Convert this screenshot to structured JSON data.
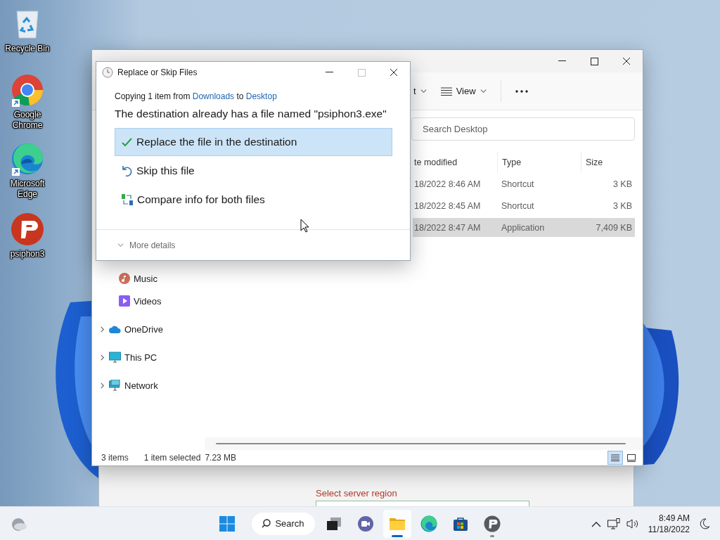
{
  "desktop_icons": [
    {
      "kind": "recycle",
      "label": "Recycle Bin",
      "shortcut": false
    },
    {
      "kind": "chrome",
      "label": "Google Chrome",
      "shortcut": true
    },
    {
      "kind": "edge",
      "label": "Microsoft Edge",
      "shortcut": true
    },
    {
      "kind": "psiphon",
      "label": "psiphon3",
      "shortcut": false
    }
  ],
  "background_window": {
    "field_label": "Select server region"
  },
  "explorer": {
    "toolbar": [
      {
        "kind": "dropdown",
        "label": "t"
      },
      {
        "kind": "view",
        "label": "View"
      }
    ],
    "search": {
      "placeholder": "Search Desktop"
    },
    "columns": [
      "te modified",
      "Type",
      "Size"
    ],
    "rows": [
      {
        "date": "18/2022 8:46 AM",
        "type": "Shortcut",
        "size": "3 KB",
        "selected": false
      },
      {
        "date": "18/2022 8:45 AM",
        "type": "Shortcut",
        "size": "3 KB",
        "selected": false
      },
      {
        "date": "18/2022 8:47 AM",
        "type": "Application",
        "size": "7,409 KB",
        "selected": true
      }
    ],
    "nav": [
      {
        "kind": "music",
        "label": "Music",
        "expandable": false
      },
      {
        "kind": "videos",
        "label": "Videos",
        "expandable": false
      },
      {
        "kind": "cloud",
        "label": "OneDrive",
        "expandable": true
      },
      {
        "kind": "pc",
        "label": "This PC",
        "expandable": true
      },
      {
        "kind": "network",
        "label": "Network",
        "expandable": true
      }
    ],
    "status": [
      "3 items",
      "1 item selected",
      "7.23 MB"
    ],
    "view_buttons": [
      {
        "kind": "details",
        "selected": true
      },
      {
        "kind": "tiles",
        "selected": false
      }
    ]
  },
  "dialog": {
    "title": "Replace or Skip Files",
    "maximize_disabled": true,
    "subtitle": [
      {
        "kind": "text",
        "text": "Copying 1 item from "
      },
      {
        "kind": "link",
        "text": "Downloads"
      },
      {
        "kind": "text",
        "text": " to "
      },
      {
        "kind": "link",
        "text": "Desktop"
      }
    ],
    "heading": "The destination already has a file named \"psiphon3.exe\"",
    "options": [
      {
        "kind": "replace",
        "label": "Replace the file in the destination",
        "selected": true
      },
      {
        "kind": "skip",
        "label": "Skip this file",
        "selected": false
      },
      {
        "kind": "compare",
        "label": "Compare info for both files",
        "selected": false
      }
    ],
    "more": "More details"
  },
  "taskbar": {
    "search": "Search",
    "apps": [
      {
        "kind": "taskview",
        "open": false,
        "focused": false
      },
      {
        "kind": "chat",
        "open": false,
        "focused": false
      },
      {
        "kind": "explorer",
        "open": true,
        "focused": true
      },
      {
        "kind": "edge",
        "open": false,
        "focused": false
      },
      {
        "kind": "store",
        "open": false,
        "focused": false
      },
      {
        "kind": "psiphon",
        "open": true,
        "focused": false
      }
    ],
    "time": "8:49 AM",
    "date": "11/18/2022"
  }
}
